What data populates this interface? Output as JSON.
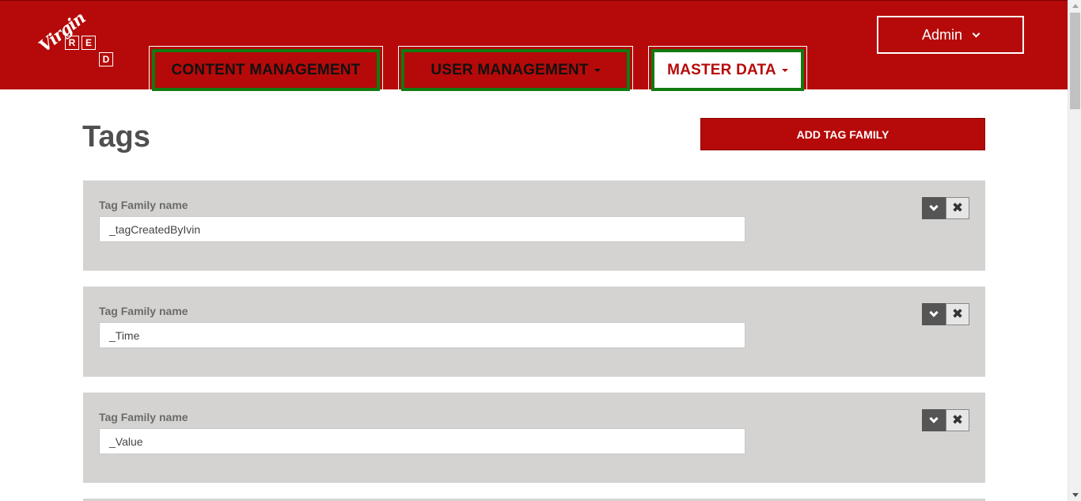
{
  "colors": {
    "brand_red": "#b50a09",
    "nav_border_green": "#117a11",
    "panel_gray": "#d4d3d2"
  },
  "logo": {
    "script": "Virgin",
    "letters": [
      "R",
      "E",
      "D"
    ]
  },
  "nav": {
    "tabs": [
      {
        "label": "CONTENT MANAGEMENT",
        "dropdown": false,
        "active": false
      },
      {
        "label": "USER MANAGEMENT",
        "dropdown": true,
        "active": false
      },
      {
        "label": "MASTER DATA",
        "dropdown": true,
        "active": true
      }
    ],
    "user_menu": {
      "label": "Admin",
      "icon": "chevron-down-icon"
    }
  },
  "page": {
    "title": "Tags",
    "add_button_label": "ADD TAG FAMILY"
  },
  "tag_families": [
    {
      "field_label": "Tag Family name",
      "value": "_tagCreatedByIvin"
    },
    {
      "field_label": "Tag Family name",
      "value": "_Time"
    },
    {
      "field_label": "Tag Family name",
      "value": "_Value"
    }
  ]
}
